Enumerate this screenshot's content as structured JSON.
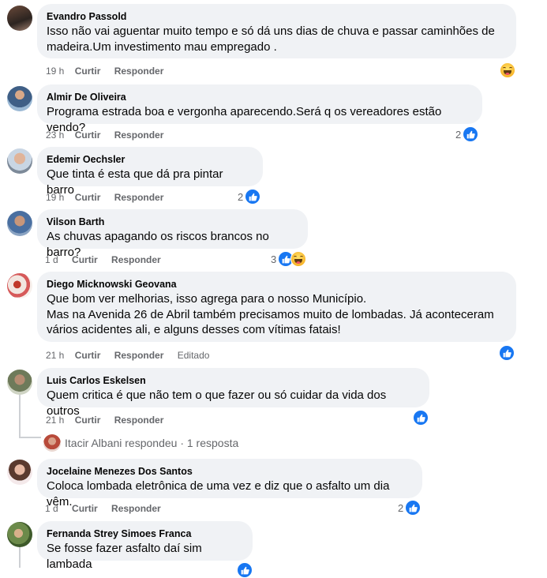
{
  "comments": [
    {
      "author": "Evandro Passold",
      "text": "Isso não vai aguentar muito tempo e só dá uns dias de chuva e passar caminhões de madeira.Um investimento mau empregado .",
      "time": "19 h",
      "like_label": "Curtir",
      "reply_label": "Responder",
      "reactions": [
        "haha"
      ],
      "count": ""
    },
    {
      "author": "Almir De Oliveira",
      "text": "Programa estrada boa e vergonha aparecendo.Será q os vereadores estão vendo?",
      "time": "23 h",
      "like_label": "Curtir",
      "reply_label": "Responder",
      "reactions": [
        "like"
      ],
      "count": "2"
    },
    {
      "author": "Edemir Oechsler",
      "text": "Que tinta é esta que dá pra pintar barro",
      "time": "19 h",
      "like_label": "Curtir",
      "reply_label": "Responder",
      "reactions": [
        "like"
      ],
      "count": "2"
    },
    {
      "author": "Vilson Barth",
      "text": "As chuvas apagando os riscos brancos no barro?",
      "time": "1 d",
      "like_label": "Curtir",
      "reply_label": "Responder",
      "reactions": [
        "like",
        "haha"
      ],
      "count": "3"
    },
    {
      "author": "Diego Micknowski Geovana",
      "text": "Que bom ver melhorias, isso agrega para o nosso Município.\nMas na Avenida 26 de Abril também precisamos muito de lombadas. Já aconteceram vários acidentes ali, e alguns desses com vítimas fatais!",
      "time": "21 h",
      "like_label": "Curtir",
      "reply_label": "Responder",
      "edited_label": "Editado",
      "reactions": [
        "like"
      ],
      "count": ""
    },
    {
      "author": "Luis Carlos Eskelsen",
      "text": "Quem critica é que não tem o que fazer ou só cuidar da vida dos outros",
      "time": "21 h",
      "like_label": "Curtir",
      "reply_label": "Responder",
      "reactions": [
        "like"
      ],
      "count": ""
    },
    {
      "author": "Jocelaine Menezes Dos Santos",
      "text": "Coloca lombada eletrônica de uma vez e diz que o asfalto um dia vêm.",
      "time": "1 d",
      "like_label": "Curtir",
      "reply_label": "Responder",
      "reactions": [
        "like"
      ],
      "count": "2"
    },
    {
      "author": "Fernanda Strey Simoes Franca",
      "text": "Se fosse fazer asfalto daí sim lambada",
      "time": "",
      "like_label": "",
      "reply_label": "",
      "reactions": [],
      "count": ""
    }
  ],
  "reply_summary": {
    "text": "Itacir Albani respondeu · 1 resposta"
  },
  "colors": {
    "bubble": "#f0f2f5",
    "like": "#1877f2",
    "meta": "#65676b",
    "text": "#050505"
  },
  "icons": {
    "like": "thumbs-up-icon",
    "haha": "laughing-face-icon"
  }
}
